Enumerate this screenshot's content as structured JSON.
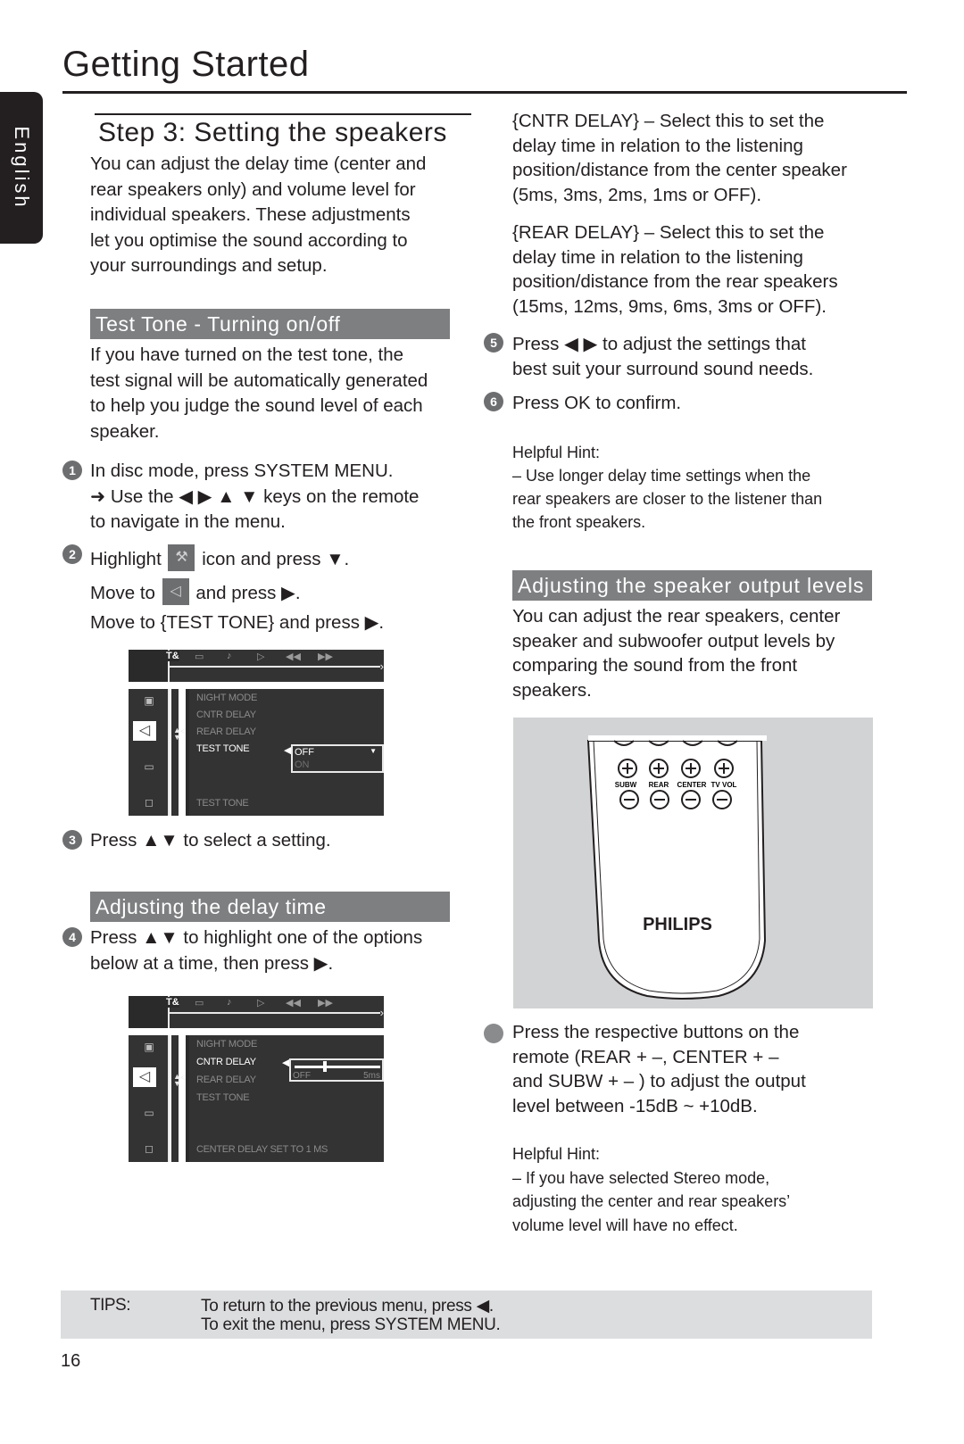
{
  "header": {
    "title": "Getting Started",
    "language_tab": "English"
  },
  "left": {
    "step_title": "Step 3:  Setting the speakers",
    "intro": [
      "You can adjust the delay time (center and",
      "rear speakers only) and volume level for",
      "individual speakers. These adjustments",
      "let you optimise the sound according to",
      "your surroundings and setup."
    ],
    "section_test_tone": "Test Tone - Turning on/off",
    "test_tone_text": [
      "If you have turned on the test tone, the",
      "test signal will be automatically generated",
      "to help you judge the sound level of each",
      "speaker."
    ],
    "step1": {
      "number": "1",
      "line1": "In disc mode, press SYSTEM MENU.",
      "line2": "➜ Use the ◀ ▶ ▲ ▼ keys on the remote",
      "line3": "to navigate in the menu."
    },
    "step2": {
      "number": "2",
      "highlight_pre": "Highlight",
      "highlight_post": "icon and press ▼.",
      "move_pre": "Move to",
      "move_post": "and press ▶.",
      "move_test_tone": "Move to {TEST TONE} and press ▶."
    },
    "step3": {
      "number": "3",
      "text": "Press ▲▼ to select a setting."
    },
    "section_delay": "Adjusting the delay time",
    "step4": {
      "number": "4",
      "line1": "Press ▲▼ to highlight one of the options",
      "line2": "below at a time, then press ▶."
    }
  },
  "osd_common": {
    "top_icons": [
      "setup-icon",
      "subtitle-icon",
      "audio-icon",
      "play-icon",
      "rewind-icon",
      "fast-forward-icon"
    ],
    "top_glyphs": [
      "T&",
      "▭",
      "♪",
      "▷",
      "◀◀",
      "▶▶"
    ],
    "side_glyphs": [
      "▣",
      "◁",
      "▭",
      "◻"
    ],
    "menu_items": [
      "NIGHT MODE",
      "CNTR DELAY",
      "REAR DELAY",
      "TEST TONE"
    ]
  },
  "osd1": {
    "highlighted": "TEST TONE",
    "dropdown_selected": "OFF",
    "dropdown_other": "ON",
    "status": "TEST TONE"
  },
  "osd2": {
    "highlighted": "CNTR DELAY",
    "slider_min_label": "OFF",
    "slider_max_label": "5ms",
    "slider_value_fraction": 0.35,
    "status": "CENTER DELAY SET TO 1 MS"
  },
  "right": {
    "cntr_delay": [
      "{CNTR DELAY} – Select this to set the",
      "delay time in relation to the listening",
      "position/distance from the center speaker",
      "(5ms, 3ms, 2ms, 1ms or OFF)."
    ],
    "rear_delay": [
      "{REAR DELAY} – Select this to set the",
      "delay time in relation to the listening",
      "position/distance from the rear speakers",
      "(15ms, 12ms, 9ms, 6ms, 3ms or OFF)."
    ],
    "step5": {
      "number": "5",
      "line1": "Press ◀  ▶  to adjust the settings that",
      "line2": "best suit your surround sound needs."
    },
    "step6": {
      "number": "6",
      "text": "Press OK to confirm."
    },
    "hint1": {
      "title": "Helpful Hint:",
      "lines": [
        "–  Use longer delay time settings when the",
        "rear speakers are closer to the listener than",
        "the front speakers."
      ]
    },
    "section_output": "Adjusting the speaker output levels",
    "output_text": [
      "You can adjust the rear speakers, center",
      "speaker and subwoofer output levels by",
      "comparing the sound from the front",
      "speakers."
    ],
    "remote": {
      "brand": "PHILIPS",
      "button_labels": [
        "SUBW",
        "REAR",
        "CENTER",
        "TV VOL"
      ]
    },
    "press_buttons": [
      "Press the respective buttons on the",
      "remote (REAR + –, CENTER + –",
      "and SUBW  + – ) to adjust the output",
      "level between -15dB ~ +10dB."
    ],
    "hint2": {
      "title": "Helpful Hint:",
      "lines": [
        "–  If you have selected Stereo mode,",
        "adjusting the center and rear speakers’",
        "volume level will have no effect."
      ]
    }
  },
  "tips": {
    "label": "TIPS:",
    "line1": "To return to the previous menu, press ◀.",
    "line2": "To exit the menu, press SYSTEM MENU."
  },
  "page_number": "16"
}
